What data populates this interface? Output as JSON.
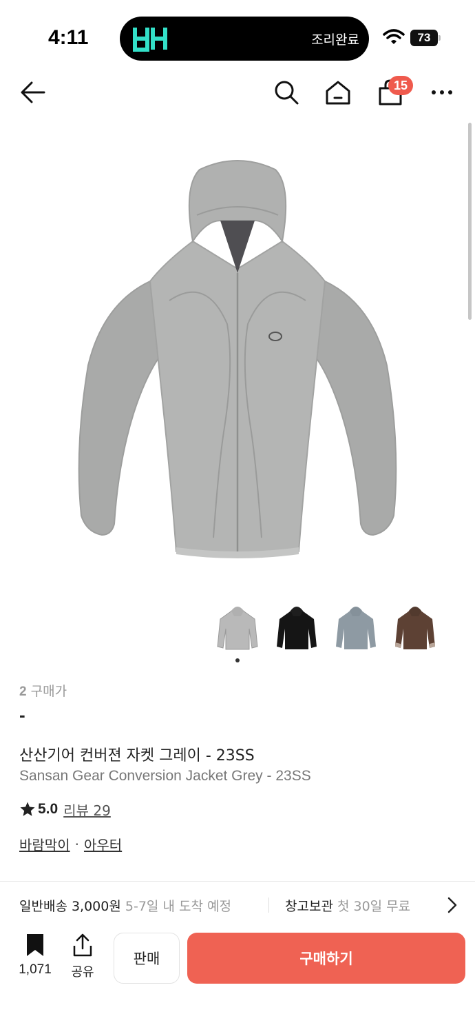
{
  "status_bar": {
    "time": "4:11",
    "island_text": "조리완료",
    "battery": "73"
  },
  "nav": {
    "cart_count": "15",
    "icons": [
      "back-arrow-icon",
      "search-icon",
      "home-icon",
      "shopping-bag-icon",
      "more-icon"
    ]
  },
  "product": {
    "image_color": "#b7b8b7",
    "thumbnails": [
      {
        "name": "grey",
        "color": "#b9b9b9"
      },
      {
        "name": "black",
        "color": "#151515"
      },
      {
        "name": "blue-grey",
        "color": "#8e9aa3"
      },
      {
        "name": "brown",
        "color": "#5d4134"
      }
    ],
    "buyers_count": "2",
    "buyers_label": "구매가",
    "price": "-",
    "title_ko": "산산기어 컨버젼 자켓 그레이 - 23SS",
    "title_en": "Sansan Gear Conversion Jacket Grey - 23SS",
    "rating": "5.0",
    "review_label": "리뷰 29",
    "category_1": "바람막이",
    "category_2": "아우터"
  },
  "delivery": {
    "standard_label": "일반배송 3,000원",
    "standard_eta": "5-7일 내 도착 예정",
    "warehouse_label": "창고보관",
    "warehouse_note": "첫 30일 무료"
  },
  "bottom_bar": {
    "bookmark_count": "1,071",
    "share_label": "공유",
    "sell_label": "판매",
    "buy_label": "구매하기",
    "buy_color": "#ef6253"
  }
}
